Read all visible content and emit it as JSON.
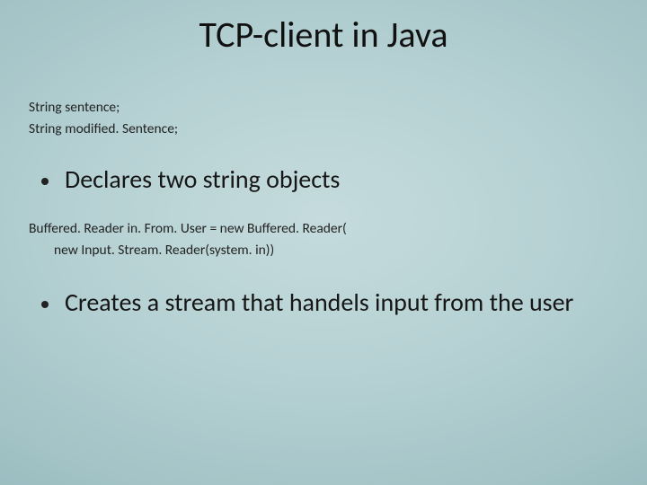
{
  "title": "TCP-client in Java",
  "code1": {
    "line1": "String sentence;",
    "line2": "String modified. Sentence;"
  },
  "bullet1": "Declares two string objects",
  "code2": {
    "line1": "Buffered. Reader in. From. User = new Buffered. Reader(",
    "line2": "new Input. Stream. Reader(system. in))"
  },
  "bullet2": "Creates a stream that handels input from the user"
}
